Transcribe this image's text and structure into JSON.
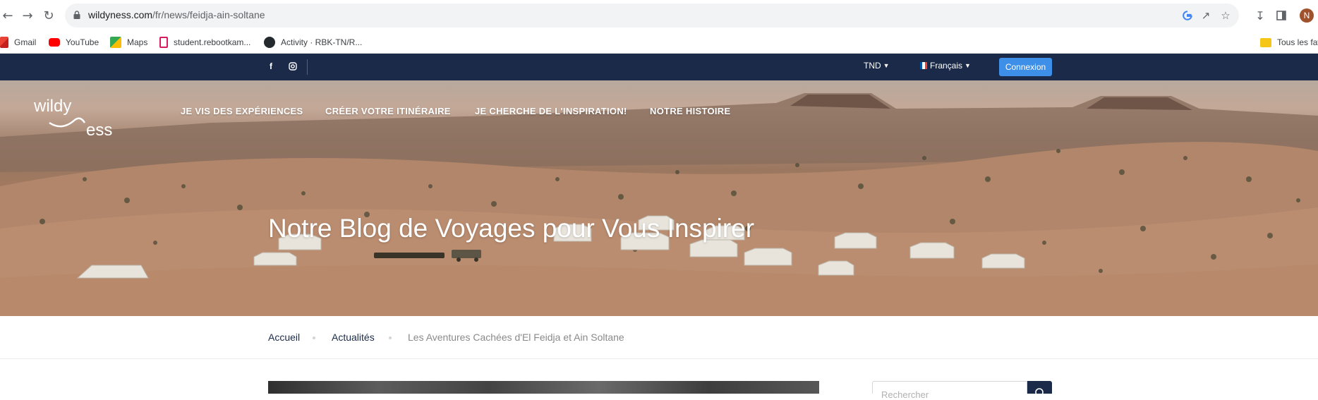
{
  "browser": {
    "url_domain": "wildyness.com",
    "url_path": "/fr/news/feidja-ain-soltane",
    "avatar_letter": "N",
    "icons": [
      "back-icon",
      "forward-icon",
      "reload-icon",
      "lock-icon",
      "google-icon",
      "share-icon",
      "star-icon",
      "download-icon",
      "sidepanel-icon"
    ],
    "bookmarks": [
      {
        "label": "Gmail",
        "icon": "gmail-icon",
        "color": "#ea4335"
      },
      {
        "label": "YouTube",
        "icon": "youtube-icon",
        "color": "#ff0000"
      },
      {
        "label": "Maps",
        "icon": "maps-icon",
        "color": "#34a853"
      },
      {
        "label": "student.rebootkam...",
        "icon": "reboot-icon",
        "color": "#d81b60"
      },
      {
        "label": "Activity · RBK-TN/R...",
        "icon": "github-icon",
        "color": "#24292e"
      },
      {
        "label": "Tous les fav",
        "icon": "folder-icon",
        "color": "#f5c518"
      }
    ]
  },
  "topbar": {
    "currency": "TND",
    "language": "Français",
    "login_label": "Connexion",
    "social": [
      "facebook-icon",
      "instagram-icon"
    ],
    "color": "#1b2a48",
    "button_color": "#3d8fe8"
  },
  "hero": {
    "logo_text_top": "wildy",
    "logo_text_bottom": "ess",
    "menu": [
      "JE VIS DES EXPÉRIENCES",
      "CRÉER VOTRE ITINÉRAIRE",
      "JE CHERCHE DE L'INSPIRATION!",
      "NOTRE HISTOIRE"
    ],
    "title": "Notre Blog de Voyages pour Vous Inspirer"
  },
  "breadcrumb": {
    "home": "Accueil",
    "news": "Actualités",
    "current": "Les Aventures Cachées d'El Feidja et Ain Soltane"
  },
  "sidebar": {
    "search_placeholder": "Rechercher"
  }
}
